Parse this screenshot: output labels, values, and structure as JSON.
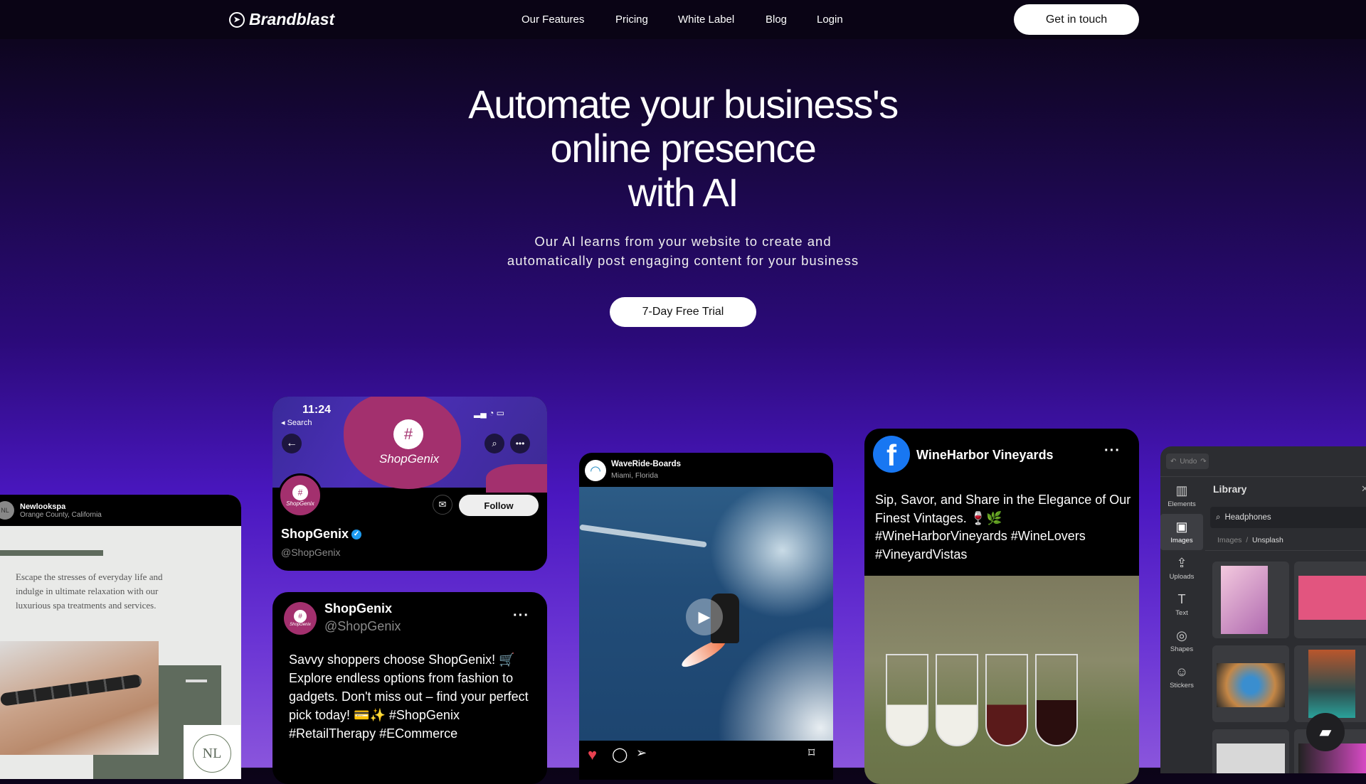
{
  "nav": {
    "brand": "Brandblast",
    "links": [
      "Our Features",
      "Pricing",
      "White Label",
      "Blog",
      "Login"
    ],
    "cta": "Get in touch"
  },
  "hero": {
    "title_lines": [
      "Automate your business's",
      "online presence",
      "with AI"
    ],
    "subtitle_lines": [
      "Our AI learns from your website to create and",
      "automatically post engaging content for your business"
    ],
    "cta": "7-Day Free Trial"
  },
  "spa_card": {
    "name": "Newlookspa",
    "location": "Orange County, California",
    "text_lines": [
      "Escape the stresses of everyday life and",
      "indulge in ultimate relaxation with our",
      "luxurious spa treatments and services."
    ],
    "logo_monogram": "NL"
  },
  "profile_card": {
    "time": "11:24",
    "back_label": "◂ Search",
    "banner_name": "ShopGenix",
    "avatar_label": "ShopGenix",
    "follow": "Follow",
    "name": "ShopGenix",
    "handle": "@ShopGenix"
  },
  "tweet_card": {
    "name": "ShopGenix",
    "handle": "@ShopGenix",
    "avatar_label": "ShopGenix",
    "text": "Savvy shoppers choose ShopGenix! 🛒 Explore endless options from fashion to gadgets. Don't miss out – find your perfect pick today! 💳✨ #ShopGenix #RetailTherapy #ECommerce"
  },
  "insta_card": {
    "name": "WaveRide-Boards",
    "location": "Miami, Florida"
  },
  "fb_card": {
    "name": "WineHarbor Vineyards",
    "text": "Sip, Savor, and Share in the Elegance of Our Finest Vintages. 🍷🌿 #WineHarborVineyards #WineLovers #VineyardVistas"
  },
  "editor": {
    "undo": "Undo",
    "panel_title": "Library",
    "search_value": "Headphones",
    "breadcrumb": [
      "Images",
      "Unsplash"
    ],
    "sidebar": [
      "Elements",
      "Images",
      "Uploads",
      "Text",
      "Shapes",
      "Stickers"
    ],
    "active_sidebar": "Images"
  },
  "colors": {
    "brand_pink": "#a3306e",
    "facebook_blue": "#1877f2",
    "heart_red": "#e8404f",
    "verified_blue": "#1d9bf0"
  }
}
